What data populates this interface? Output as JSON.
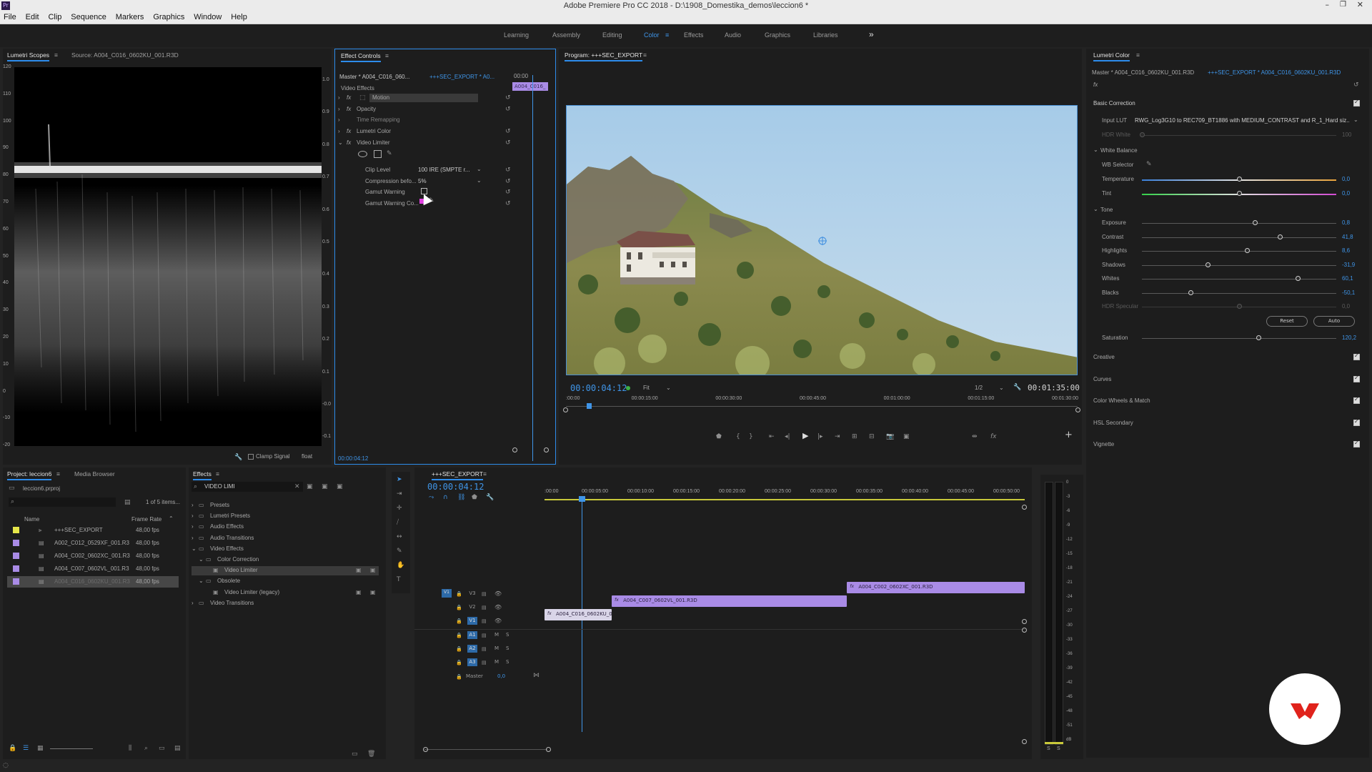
{
  "app": {
    "title": "Adobe Premiere Pro CC 2018 - D:\\1908_Domestika_demos\\leccion6 *",
    "menu": [
      "File",
      "Edit",
      "Clip",
      "Sequence",
      "Markers",
      "Graphics",
      "Window",
      "Help"
    ]
  },
  "workspaces": {
    "items": [
      "Learning",
      "Assembly",
      "Editing",
      "Color",
      "Effects",
      "Audio",
      "Graphics",
      "Libraries"
    ],
    "active": "Color",
    "more": "»"
  },
  "scopes": {
    "tab": "Lumetri Scopes",
    "source_tab": "Source: A004_C016_0602KU_001.R3D",
    "left_axis": [
      "120",
      "110",
      "100",
      "90",
      "80",
      "70",
      "60",
      "50",
      "40",
      "30",
      "20",
      "10",
      "0",
      "-10",
      "-20"
    ],
    "right_axis": [
      "1.0",
      "0.9",
      "0.8",
      "0.7",
      "0.6",
      "0.5",
      "0.4",
      "0.3",
      "0.2",
      "0.1",
      "-0.0",
      "-0.1"
    ],
    "clamp_label": "Clamp Signal",
    "float_label": "float"
  },
  "effect_controls": {
    "tab": "Effect Controls",
    "master": "Master * A004_C016_060...",
    "sequence": "+++SEC_EXPORT * A0...",
    "time": "00:00",
    "clip_label": "A004_C016_",
    "section": "Video Effects",
    "effects": [
      "Motion",
      "Opacity",
      "Time Remapping",
      "Lumetri Color",
      "Video Limiter"
    ],
    "params": [
      {
        "label": "Clip Level",
        "value": "100 IRE (SMPTE r..."
      },
      {
        "label": "Compression befo...",
        "value": "5%"
      },
      {
        "label": "Gamut Warning",
        "value": ""
      },
      {
        "label": "Gamut Warning Co...",
        "value": ""
      }
    ],
    "footer_tc": "00:00:04:12"
  },
  "program": {
    "tab": "Program: +++SEC_EXPORT",
    "timecode": "00:00:04:12",
    "fit": "Fit",
    "resolution": "1/2",
    "duration": "00:01:35:00",
    "ruler": [
      ":00:00",
      "00:00:15:00",
      "00:00:30:00",
      "00:00:45:00",
      "00:01:00:00",
      "00:01:15:00",
      "00:01:30:00"
    ],
    "playhead_pct": 4
  },
  "lumetri": {
    "tab": "Lumetri Color",
    "master": "Master * A004_C016_0602KU_001.R3D",
    "sequence": "+++SEC_EXPORT * A004_C016_0602KU_001.R3D",
    "fx": "fx",
    "basic": "Basic Correction",
    "input_lut_label": "Input LUT",
    "input_lut": "RWG_Log3G10 to REC709_BT1886 with MEDIUM_CONTRAST and R_1_Hard siz...",
    "hdr_white": "HDR White",
    "hdr_white_val": "100",
    "wb": "White Balance",
    "wb_selector": "WB Selector",
    "temperature": {
      "label": "Temperature",
      "value": "0,0",
      "pos": 0.5
    },
    "tint": {
      "label": "Tint",
      "value": "0,0",
      "pos": 0.5
    },
    "tone": "Tone",
    "sliders": [
      {
        "label": "Exposure",
        "value": "0,8",
        "pos": 0.58
      },
      {
        "label": "Contrast",
        "value": "41,8",
        "pos": 0.71
      },
      {
        "label": "Highlights",
        "value": "8,6",
        "pos": 0.54
      },
      {
        "label": "Shadows",
        "value": "-31,9",
        "pos": 0.34
      },
      {
        "label": "Whites",
        "value": "60,1",
        "pos": 0.8
      },
      {
        "label": "Blacks",
        "value": "-50,1",
        "pos": 0.25
      },
      {
        "label": "HDR Specular",
        "value": "0,0",
        "pos": 0.5
      }
    ],
    "reset": "Reset",
    "auto": "Auto",
    "saturation": {
      "label": "Saturation",
      "value": "120,2",
      "pos": 0.6
    },
    "sections": [
      "Creative",
      "Curves",
      "Color Wheels & Match",
      "HSL Secondary",
      "Vignette"
    ]
  },
  "project": {
    "tab": "Project: leccion6",
    "media_tab": "Media Browser",
    "file": "leccion6.prproj",
    "count": "1 of 5 items...",
    "col_name": "Name",
    "col_rate": "Frame Rate",
    "items": [
      {
        "name": "+++SEC_EXPORT",
        "rate": "48,00 fps",
        "color": "#e6e64a",
        "selected": false
      },
      {
        "name": "A002_C012_0529XF_001.R3",
        "rate": "48,00 fps",
        "color": "#a98be6",
        "selected": false
      },
      {
        "name": "A004_C002_0602XC_001.R3",
        "rate": "48,00 fps",
        "color": "#a98be6",
        "selected": false
      },
      {
        "name": "A004_C007_0602VL_001.R3",
        "rate": "48,00 fps",
        "color": "#a98be6",
        "selected": false
      },
      {
        "name": "A004_C016_0602KU_001.R3",
        "rate": "48,00 fps",
        "color": "#a98be6",
        "selected": true
      }
    ]
  },
  "effects": {
    "tab": "Effects",
    "search": "VIDEO LIMI",
    "tree": [
      {
        "label": "Presets",
        "indent": 0,
        "kind": "folder"
      },
      {
        "label": "Lumetri Presets",
        "indent": 0,
        "kind": "folder"
      },
      {
        "label": "Audio Effects",
        "indent": 0,
        "kind": "folder"
      },
      {
        "label": "Audio Transitions",
        "indent": 0,
        "kind": "folder"
      },
      {
        "label": "Video Effects",
        "indent": 0,
        "kind": "folder"
      },
      {
        "label": "Color Correction",
        "indent": 1,
        "kind": "folder"
      },
      {
        "label": "Video Limiter",
        "indent": 2,
        "kind": "effect",
        "selected": true
      },
      {
        "label": "Obsolete",
        "indent": 1,
        "kind": "folder"
      },
      {
        "label": "Video Limiter (legacy)",
        "indent": 2,
        "kind": "effect"
      },
      {
        "label": "Video Transitions",
        "indent": 0,
        "kind": "folder"
      }
    ]
  },
  "timeline": {
    "tab": "+++SEC_EXPORT",
    "timecode": "00:00:04:12",
    "ruler": [
      ":00:00",
      "00:00:05:00",
      "00:00:10:00",
      "00:00:15:00",
      "00:00:20:00",
      "00:00:25:00",
      "00:00:30:00",
      "00:00:35:00",
      "00:00:40:00",
      "00:00:45:00",
      "00:00:50:00"
    ],
    "tracks": [
      "V3",
      "V2",
      "V1",
      "A1",
      "A2",
      "A3"
    ],
    "master": "Master",
    "master_val": "0,0",
    "clips": [
      {
        "name": "A004_C002_0602XC_001.R3D",
        "track": 0,
        "start": 0.63,
        "end": 1.0,
        "color": "#a98be6"
      },
      {
        "name": "A004_C007_0602VL_001.R3D",
        "track": 1,
        "start": 0.14,
        "end": 0.63,
        "color": "#a98be6"
      },
      {
        "name": "A004_C016_0602KU_00",
        "track": 2,
        "start": 0.0,
        "end": 0.14,
        "color": "#d9d5e8"
      }
    ],
    "meter": [
      "0",
      "-3",
      "-6",
      "-9",
      "-12",
      "-15",
      "-18",
      "-21",
      "-24",
      "-27",
      "-30",
      "-33",
      "-36",
      "-39",
      "-42",
      "-45",
      "-48",
      "-51",
      "dB"
    ],
    "meter_bottom": [
      "S",
      "S"
    ]
  }
}
